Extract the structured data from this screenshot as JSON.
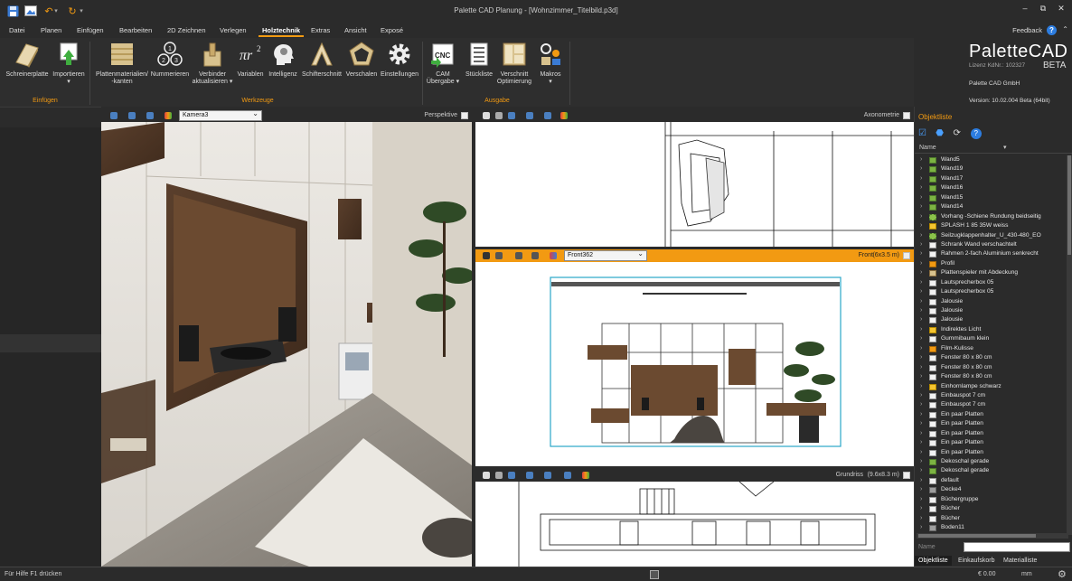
{
  "window": {
    "title": "Palette CAD Planung - [Wohnzimmer_Titelbild.p3d]"
  },
  "menu": {
    "tabs": [
      "Datei",
      "Planen",
      "Einfügen",
      "Bearbeiten",
      "2D Zeichnen",
      "Verlegen",
      "Holztechnik",
      "Extras",
      "Ansicht",
      "Exposé"
    ],
    "active": "Holztechnik",
    "feedback_label": "Feedback",
    "help": "?"
  },
  "ribbon": {
    "groups": {
      "einfuegen": "Einfügen",
      "werkzeuge": "Werkzeuge",
      "ausgabe": "Ausgabe"
    },
    "buttons": {
      "schreinerplatte": "Schreinerplatte",
      "importieren": "Importieren\n▾",
      "plattenmaterialien": "Plattenmaterialien/\n-kanten",
      "nummerieren": "Nummerieren",
      "verbinder": "Verbinder\naktualisieren ▾",
      "variablen": "Variablen",
      "intelligenz": "Intelligenz",
      "schifterschnitt": "Schifterschnitt",
      "verschalen": "Verschalen",
      "einstellungen": "Einstellungen",
      "cam": "CAM\nÜbergabe ▾",
      "stueckliste": "Stückliste",
      "verschnitt": "Verschnitt\nOptimierung",
      "makros": "Makros\n▾"
    }
  },
  "brand": {
    "name": "PaletteCAD",
    "beta": "BETA",
    "license": "Lizenz KdNr.: 102327",
    "company": "Palette CAD GmbH",
    "version": "Version: 10.02.004 Beta (64bit)"
  },
  "viewports": {
    "perspective": {
      "name": "Perspektive",
      "camera": "Kamera3"
    },
    "axonometric": {
      "name": "Axonometrie"
    },
    "front": {
      "name": "Front",
      "scale": "(6x3.5 m)",
      "camera": "Front362"
    },
    "ground": {
      "name": "Grundriss",
      "scale": "(9.6x8.3 m)"
    }
  },
  "objectlist": {
    "title": "Objektliste",
    "name_header": "Name",
    "name_field_label": "Name",
    "name_field_value": "",
    "items": [
      {
        "label": "Wand5",
        "icon": "wall"
      },
      {
        "label": "Wand19",
        "icon": "wall"
      },
      {
        "label": "Wand17",
        "icon": "wall"
      },
      {
        "label": "Wand16",
        "icon": "wall"
      },
      {
        "label": "Wand15",
        "icon": "wall"
      },
      {
        "label": "Wand14",
        "icon": "wall"
      },
      {
        "label": "Vorhang -Schiene Rundung beidseitig",
        "icon": "rail"
      },
      {
        "label": "SPLASH 1  85 35W weiss",
        "icon": "light"
      },
      {
        "label": "Seilzugklappenhalter_U_430-480_EO",
        "icon": "rail"
      },
      {
        "label": "Schrank Wand verschachtelt",
        "icon": "cabinet"
      },
      {
        "label": "Rahmen 2-fach Aluminium senkrecht",
        "icon": "cabinet"
      },
      {
        "label": "Profil",
        "icon": "profile"
      },
      {
        "label": "Plattenspieler mit Abdeckung",
        "icon": "board"
      },
      {
        "label": "Lautsprecherbox 05",
        "icon": "cabinet"
      },
      {
        "label": "Lautsprecherbox 05",
        "icon": "cabinet"
      },
      {
        "label": "Jalousie",
        "icon": "cabinet"
      },
      {
        "label": "Jalousie",
        "icon": "cabinet"
      },
      {
        "label": "Jalousie",
        "icon": "cabinet"
      },
      {
        "label": "Indirektes Licht",
        "icon": "light"
      },
      {
        "label": "Gummibaum klein",
        "icon": "cabinet"
      },
      {
        "label": "Film-Kulisse",
        "icon": "profile"
      },
      {
        "label": "Fenster 80 x 80 cm",
        "icon": "cabinet"
      },
      {
        "label": "Fenster 80 x 80 cm",
        "icon": "cabinet"
      },
      {
        "label": "Fenster 80 x 80 cm",
        "icon": "cabinet"
      },
      {
        "label": "Einhornlampe schwarz",
        "icon": "light"
      },
      {
        "label": "Einbauspot  7 cm",
        "icon": "cabinet"
      },
      {
        "label": "Einbauspot  7 cm",
        "icon": "cabinet"
      },
      {
        "label": "Ein paar Platten",
        "icon": "cabinet"
      },
      {
        "label": "Ein paar Platten",
        "icon": "cabinet"
      },
      {
        "label": "Ein paar Platten",
        "icon": "cabinet"
      },
      {
        "label": "Ein paar Platten",
        "icon": "cabinet"
      },
      {
        "label": "Ein paar Platten",
        "icon": "cabinet"
      },
      {
        "label": "Dekoschal gerade",
        "icon": "wall"
      },
      {
        "label": "Dekoschal gerade",
        "icon": "wall"
      },
      {
        "label": "default",
        "icon": "cabinet"
      },
      {
        "label": "Decke4",
        "icon": "ceiling"
      },
      {
        "label": "Büchergruppe",
        "icon": "cabinet"
      },
      {
        "label": "Bücher",
        "icon": "cabinet"
      },
      {
        "label": "Bücher",
        "icon": "cabinet"
      },
      {
        "label": "Boden11",
        "icon": "ceiling"
      }
    ],
    "tabs": [
      "Objektliste",
      "Einkaufskorb",
      "Materialliste"
    ]
  },
  "status": {
    "help": "Für Hilfe F1 drücken",
    "cost": "€ 0.00",
    "unit": "mm"
  },
  "colors": {
    "accent": "#f29a12",
    "help_blue": "#2d7de0"
  }
}
